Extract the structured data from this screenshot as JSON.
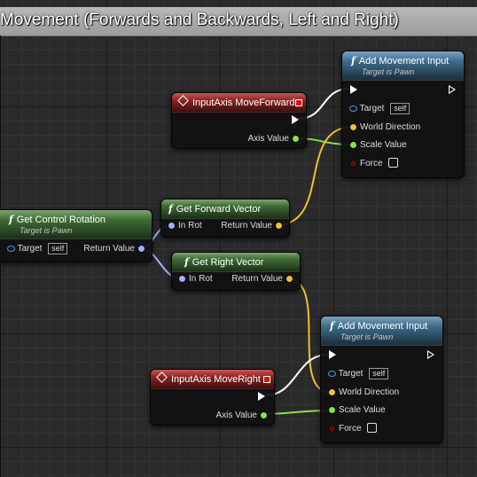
{
  "comment": {
    "title": "Movement (Forwards and Backwards, Left and Right)"
  },
  "colors": {
    "exec": "#ffffff",
    "object": "#3aa0ff",
    "vector": "#f0c030",
    "rotator": "#a0b0ff",
    "float": "#8ae04a",
    "bool": "#8b1a1a"
  },
  "add_movement_top": {
    "icon": "function-icon",
    "title": "Add Movement Input",
    "subtitle": "Target is Pawn",
    "target_label": "Target",
    "target_value": "self",
    "world_direction_label": "World Direction",
    "scale_value_label": "Scale Value",
    "force_label": "Force"
  },
  "add_movement_bottom": {
    "icon": "function-icon",
    "title": "Add Movement Input",
    "subtitle": "Target is Pawn",
    "target_label": "Target",
    "target_value": "self",
    "world_direction_label": "World Direction",
    "scale_value_label": "Scale Value",
    "force_label": "Force"
  },
  "input_forward": {
    "icon": "input-axis-event-icon",
    "title": "InputAxis MoveForward",
    "axis_value_label": "Axis Value"
  },
  "input_right": {
    "icon": "input-axis-event-icon",
    "title": "InputAxis MoveRight",
    "axis_value_label": "Axis Value"
  },
  "get_control_rotation": {
    "icon": "function-icon",
    "title": "Get Control Rotation",
    "subtitle": "Target is Pawn",
    "target_label": "Target",
    "target_value": "self",
    "return_value_label": "Return Value"
  },
  "get_forward_vector": {
    "icon": "function-icon",
    "title": "Get Forward Vector",
    "in_rot_label": "In Rot",
    "return_value_label": "Return Value"
  },
  "get_right_vector": {
    "icon": "function-icon",
    "title": "Get Right Vector",
    "in_rot_label": "In Rot",
    "return_value_label": "Return Value"
  },
  "glyphs": {
    "function": "f"
  }
}
